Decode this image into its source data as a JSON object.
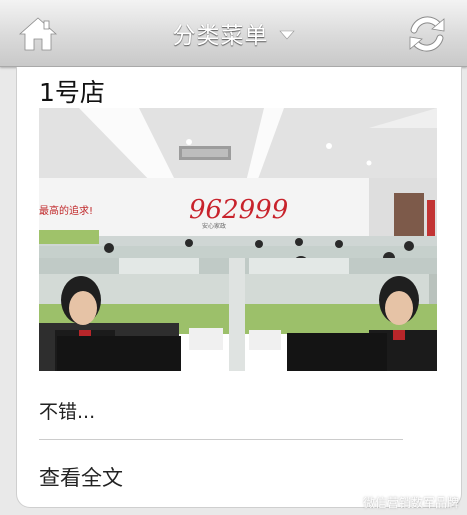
{
  "header": {
    "menu_label": "分类菜单",
    "colors": {
      "bar_top": "#f3f3f3",
      "bar_bottom": "#c9c9c9",
      "icon": "#ffffff"
    },
    "icons": [
      "home-icon",
      "chevron-down-icon",
      "refresh-icon"
    ]
  },
  "article": {
    "store_name": "1号店",
    "excerpt": "不错...",
    "read_more": "查看全文",
    "photo": {
      "wall_slogan": "最高的追求!",
      "wall_logo": "962999",
      "wall_logo_sub": "安心家政"
    }
  },
  "watermark": "微信营销数军品牌"
}
